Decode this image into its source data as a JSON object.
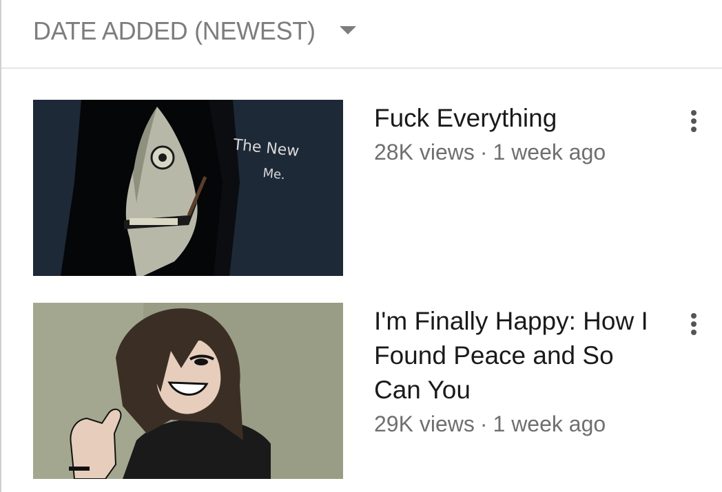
{
  "sort": {
    "label": "DATE ADDED (NEWEST)",
    "icon": "caret-down-icon"
  },
  "videos": [
    {
      "title": "Fuck Everything",
      "views": "28K views",
      "separator": "·",
      "age": "1 week ago",
      "thumbnail_text": [
        "The New",
        "Me."
      ],
      "menu_icon": "more-vert-icon"
    },
    {
      "title": "I'm Finally Happy: How I Found Peace and So Can You",
      "views": "29K views",
      "separator": "·",
      "age": "1 week ago",
      "menu_icon": "more-vert-icon"
    }
  ],
  "colors": {
    "sort_text": "#7d7d7d",
    "title_text": "#1a1a1a",
    "meta_text": "#6f6f6f",
    "thumb1_bg": "#1b2633",
    "thumb2_bg": "#9a9d85"
  }
}
